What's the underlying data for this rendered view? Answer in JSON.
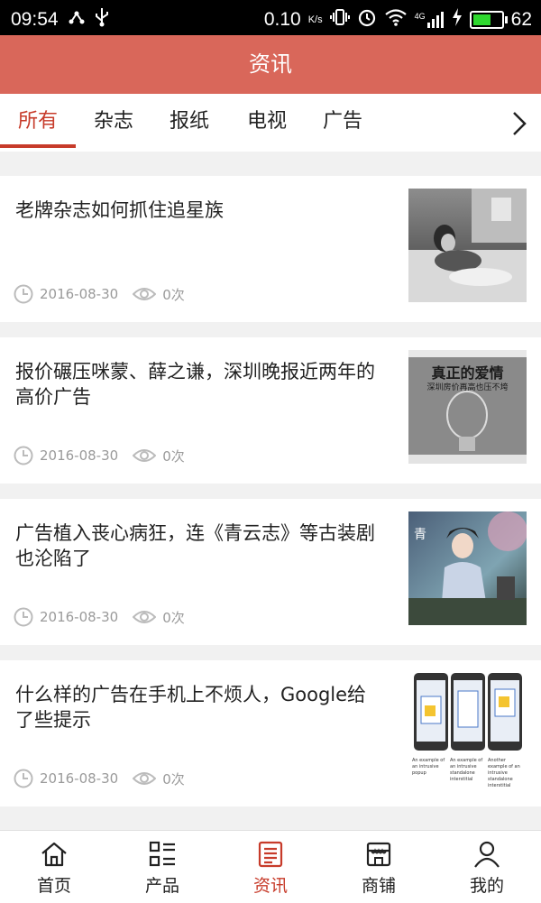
{
  "status_bar": {
    "time": "09:54",
    "speed": "0.10",
    "speed_unit": "K/s",
    "network": "4G",
    "battery": "62",
    "battery_level": 0.62,
    "battery_color": "#2fd92f"
  },
  "header": {
    "title": "资讯",
    "bg_color": "#d9675a"
  },
  "tabs": [
    {
      "label": "所有",
      "active": true
    },
    {
      "label": "杂志",
      "active": false
    },
    {
      "label": "报纸",
      "active": false
    },
    {
      "label": "电视",
      "active": false
    },
    {
      "label": "广告",
      "active": false
    }
  ],
  "accent_color": "#c73b2a",
  "articles": [
    {
      "title": "老牌杂志如何抓住追星族",
      "date": "2016-08-30",
      "views": "0次",
      "thumb": "magazine-photo"
    },
    {
      "title": "报价碾压咪蒙、薛之谦，深圳晚报近两年的高价广告",
      "date": "2016-08-30",
      "views": "0次",
      "thumb": "newspaper-ad",
      "thumb_headline": "真正的爱情",
      "thumb_sub": "深圳房价再高也压不垮"
    },
    {
      "title": "广告植入丧心病狂，连《青云志》等古装剧也沦陷了",
      "date": "2016-08-30",
      "views": "0次",
      "thumb": "drama-still"
    },
    {
      "title": "什么样的广告在手机上不烦人，Google给了些提示",
      "date": "2016-08-30",
      "views": "0次",
      "thumb": "phone-mockups",
      "thumb_captions": [
        "An example of an intrusive popup",
        "An example of an intrusive standalone interstitial",
        "Another example of an intrusive standalone interstitial"
      ]
    }
  ],
  "bottom_nav": [
    {
      "label": "首页",
      "icon": "home-icon",
      "active": false
    },
    {
      "label": "产品",
      "icon": "products-grid-icon",
      "active": false
    },
    {
      "label": "资讯",
      "icon": "news-icon",
      "active": true
    },
    {
      "label": "商铺",
      "icon": "shop-icon",
      "active": false
    },
    {
      "label": "我的",
      "icon": "user-icon",
      "active": false
    }
  ]
}
